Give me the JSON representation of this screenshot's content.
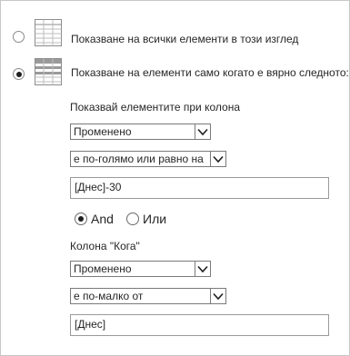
{
  "options": {
    "show_all": {
      "label": "Показване на всички елементи в този изглед",
      "selected": false,
      "icon": "table-all-icon"
    },
    "show_filtered": {
      "label": "Показване на елементи само когато е вярно следното:",
      "selected": true,
      "icon": "table-filter-icon"
    }
  },
  "filter": {
    "column_label": "Показвай елементите при колона",
    "condition1": {
      "column": "Променено",
      "operator": "е по-голямо или равно на",
      "value": "[Днес]-30"
    },
    "logic": {
      "and_label": "And",
      "or_label": "Или",
      "selected": "and"
    },
    "condition2": {
      "column_label": "Колона \"Кога\"",
      "column": "Променено",
      "operator": "е по-малко от",
      "value": "[Днес]"
    }
  },
  "colors": {
    "border": "#c8c8c8",
    "text": "#262626",
    "control_border": "#7a7a7a"
  }
}
